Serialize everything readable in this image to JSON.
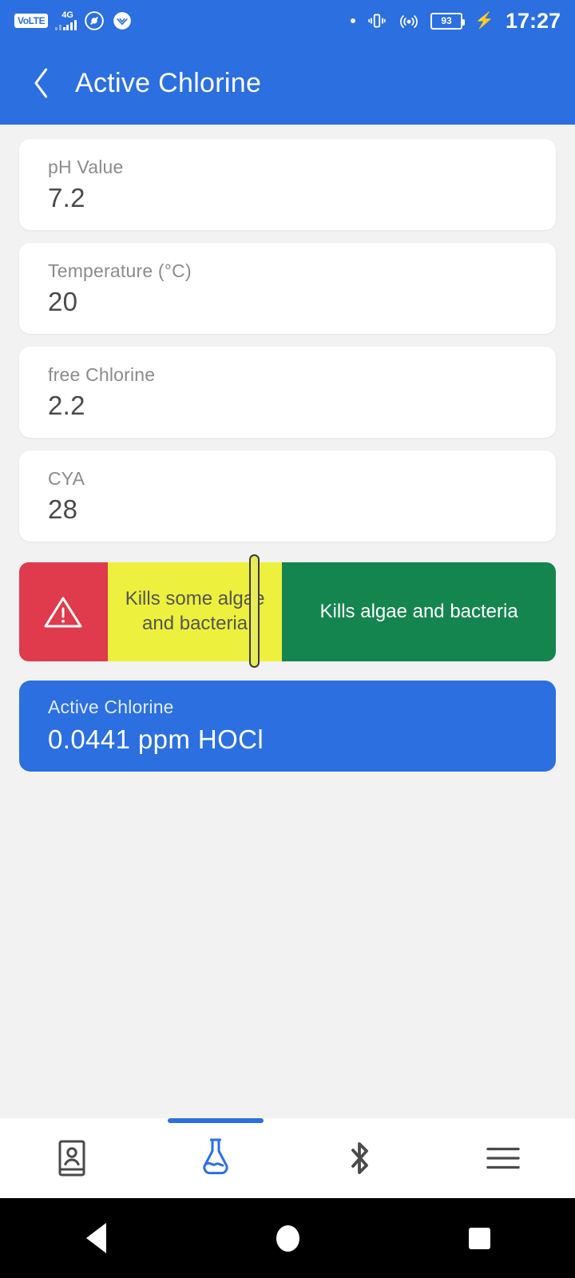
{
  "status_bar": {
    "volte_label": "VoLTE",
    "network_type": "4G",
    "battery_level": "93",
    "time": "17:27",
    "icons": [
      "volte-badge",
      "signal-bars-icon",
      "app-circle-icon",
      "app-shield-icon",
      "notification-dot-icon",
      "vibrate-icon",
      "hotspot-icon",
      "battery-icon",
      "charging-bolt-icon"
    ]
  },
  "app_bar": {
    "back_icon": "chevron-left-icon",
    "title": "Active Chlorine"
  },
  "measurements": [
    {
      "label": "pH Value",
      "value": "7.2"
    },
    {
      "label": "Temperature (°C)",
      "value": "20"
    },
    {
      "label": "free Chlorine",
      "value": "2.2"
    },
    {
      "label": "CYA",
      "value": "28"
    }
  ],
  "scale": {
    "segments": [
      {
        "name": "danger",
        "label": "",
        "color": "#df3b4c",
        "width_pct": 16.5,
        "icon": "warning-triangle-icon"
      },
      {
        "name": "partial",
        "label": "Kills some algae and bacteria",
        "color": "#edf03c",
        "width_pct": 32.5,
        "icon": ""
      },
      {
        "name": "effective",
        "label": "Kills algae and bacteria",
        "color": "#15854f",
        "width_pct": 51.0,
        "icon": ""
      }
    ],
    "marker_position_pct": 43.8
  },
  "result": {
    "label": "Active Chlorine",
    "value": "0.0441 ppm HOCl"
  },
  "bottom_nav": {
    "items": [
      {
        "name": "contacts",
        "icon": "contact-book-icon",
        "active": false
      },
      {
        "name": "measure",
        "icon": "flask-icon",
        "active": true
      },
      {
        "name": "bluetooth",
        "icon": "bluetooth-icon",
        "active": false
      },
      {
        "name": "menu",
        "icon": "hamburger-menu-icon",
        "active": false
      }
    ],
    "active_color": "#2b6fe0",
    "inactive_color": "#4a4a4a"
  },
  "system_nav": {
    "items": [
      "back-button",
      "home-button",
      "recents-button"
    ]
  },
  "colors": {
    "primary_blue": "#2b6fe0",
    "danger_red": "#df3b4c",
    "warn_yellow": "#edf03c",
    "ok_green": "#15854f",
    "page_background": "#f2f2f2",
    "card_background": "#ffffff"
  }
}
